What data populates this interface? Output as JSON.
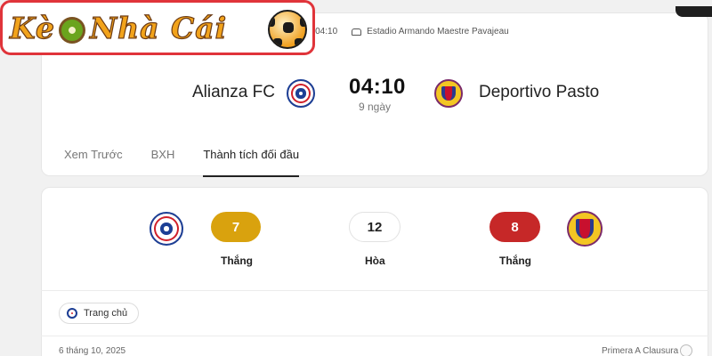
{
  "logo": {
    "part1": "Kè",
    "part2": "Nhà Cái"
  },
  "match": {
    "meta_time": "e, 04:10",
    "stadium": "Estadio Armando Maestre Pavajeau",
    "home_team": "Alianza FC",
    "away_team": "Deportivo Pasto",
    "kickoff_time": "04:10",
    "countdown": "9 ngày"
  },
  "tabs": [
    {
      "label": "Xem Trước"
    },
    {
      "label": "BXH"
    },
    {
      "label": "Thành tích đối đầu"
    }
  ],
  "head_to_head": {
    "home_wins": "7",
    "draws": "12",
    "away_wins": "8",
    "home_label": "Thắng",
    "draw_label": "Hòa",
    "away_label": "Thắng"
  },
  "filter": {
    "label": "Trang chủ"
  },
  "match_row": {
    "date": "6 tháng 10, 2025",
    "competition": "Primera A Clausura"
  },
  "colors": {
    "home_pill": "#d9a20e",
    "away_pill": "#c62828",
    "logo_border": "#e0343a",
    "logo_text": "#f2a31b"
  }
}
